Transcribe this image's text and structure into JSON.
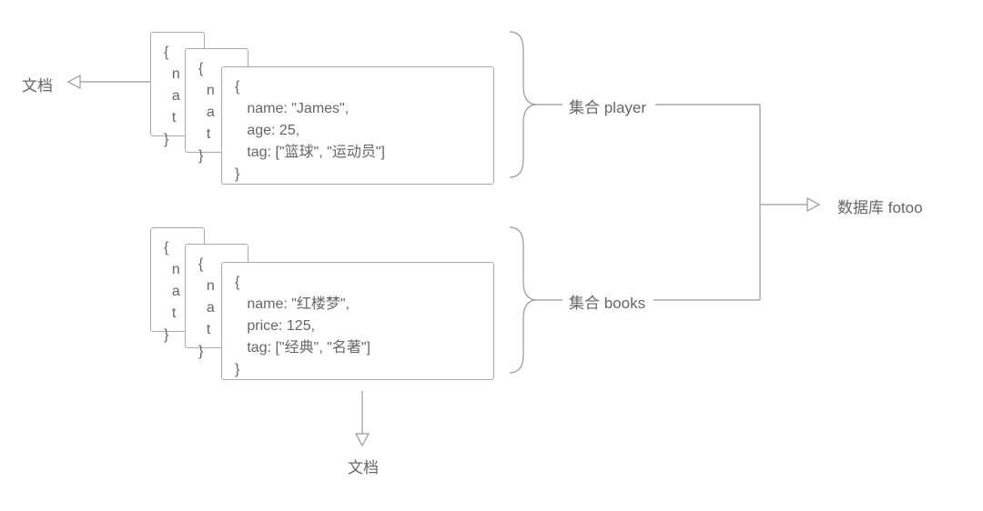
{
  "labels": {
    "document_left": "文档",
    "document_bottom": "文档",
    "collection_player": "集合 player",
    "collection_books": "集合 books",
    "database": "数据库 fotoo"
  },
  "stacks": {
    "player": {
      "back2": "{\n  n\n  a\n  t\n}",
      "back1": "{\n  n\n  a\n  t\n}",
      "front": "{\n   name: \"James\",\n   age: 25,\n   tag: [\"篮球\", \"运动员\"]\n}"
    },
    "books": {
      "back2": "{\n  n\n  a\n  t\n}",
      "back1": "{\n  n\n  a\n  t\n}",
      "front": "{\n   name: \"红楼梦\",\n   price: 125,\n   tag: [\"经典\", \"名著\"]\n}"
    }
  }
}
